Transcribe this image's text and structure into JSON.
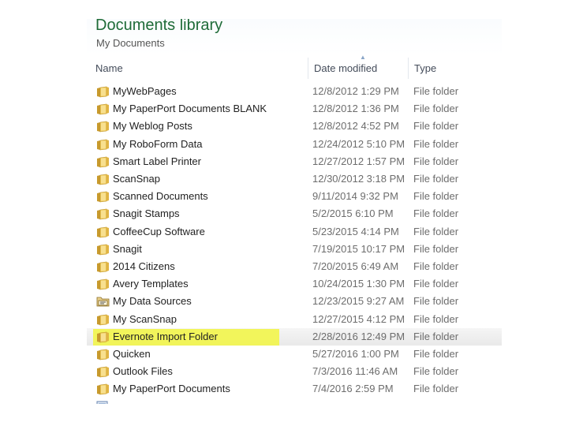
{
  "library": {
    "title": "Documents library",
    "subtitle": "My Documents"
  },
  "columns": {
    "name": "Name",
    "date": "Date modified",
    "type": "Type"
  },
  "files": [
    {
      "name": "MyWebPages",
      "date": "12/8/2012 1:29 PM",
      "type": "File folder",
      "icon": "folder-icon"
    },
    {
      "name": "My PaperPort Documents BLANK",
      "date": "12/8/2012 1:36 PM",
      "type": "File folder",
      "icon": "folder-icon"
    },
    {
      "name": "My Weblog Posts",
      "date": "12/8/2012 4:52 PM",
      "type": "File folder",
      "icon": "folder-icon"
    },
    {
      "name": "My RoboForm Data",
      "date": "12/24/2012 5:10 PM",
      "type": "File folder",
      "icon": "folder-icon"
    },
    {
      "name": "Smart Label Printer",
      "date": "12/27/2012 1:57 PM",
      "type": "File folder",
      "icon": "folder-icon"
    },
    {
      "name": "ScanSnap",
      "date": "12/30/2012 3:18 PM",
      "type": "File folder",
      "icon": "folder-icon"
    },
    {
      "name": "Scanned Documents",
      "date": "9/11/2014 9:32 PM",
      "type": "File folder",
      "icon": "folder-icon"
    },
    {
      "name": "Snagit Stamps",
      "date": "5/2/2015 6:10 PM",
      "type": "File folder",
      "icon": "folder-icon"
    },
    {
      "name": "CoffeeCup Software",
      "date": "5/23/2015 4:14 PM",
      "type": "File folder",
      "icon": "folder-icon"
    },
    {
      "name": "Snagit",
      "date": "7/19/2015 10:17 PM",
      "type": "File folder",
      "icon": "folder-icon"
    },
    {
      "name": "2014 Citizens",
      "date": "7/20/2015 6:49 AM",
      "type": "File folder",
      "icon": "folder-icon"
    },
    {
      "name": "Avery Templates",
      "date": "10/24/2015 1:30 PM",
      "type": "File folder",
      "icon": "folder-icon"
    },
    {
      "name": "My Data Sources",
      "date": "12/23/2015 9:27 AM",
      "type": "File folder",
      "icon": "data-sources-folder-icon"
    },
    {
      "name": "My ScanSnap",
      "date": "12/27/2015 4:12 PM",
      "type": "File folder",
      "icon": "folder-icon"
    },
    {
      "name": "Evernote Import Folder",
      "date": "2/28/2016 12:49 PM",
      "type": "File folder",
      "icon": "folder-icon",
      "highlighted": true
    },
    {
      "name": "Quicken",
      "date": "5/27/2016 1:00 PM",
      "type": "File folder",
      "icon": "folder-icon"
    },
    {
      "name": "Outlook Files",
      "date": "7/3/2016 11:46 AM",
      "type": "File folder",
      "icon": "folder-icon"
    },
    {
      "name": "My PaperPort Documents",
      "date": "7/4/2016 2:59 PM",
      "type": "File folder",
      "icon": "folder-icon"
    }
  ],
  "colors": {
    "title_green": "#1e6b37",
    "highlight_yellow": "#f2f54a",
    "folder_yellow": "#e8c25a"
  }
}
